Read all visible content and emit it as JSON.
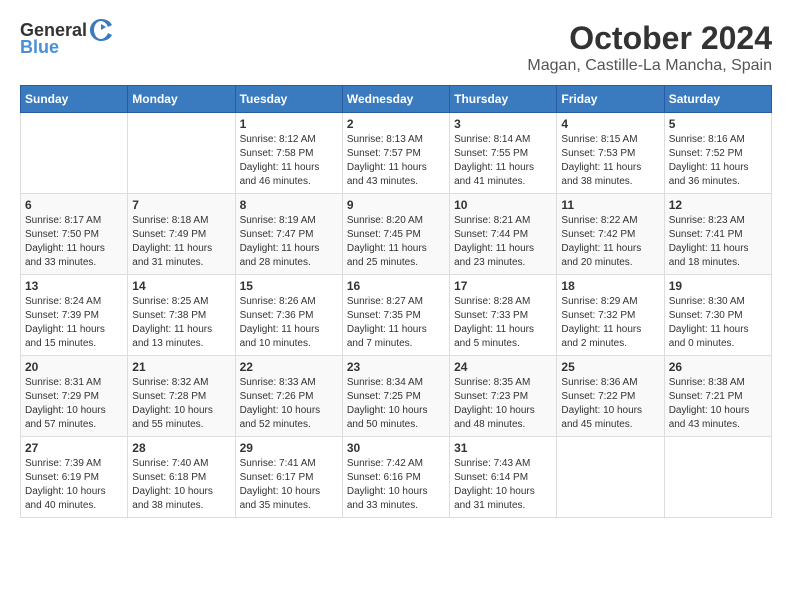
{
  "logo": {
    "general": "General",
    "blue": "Blue"
  },
  "title": "October 2024",
  "location": "Magan, Castille-La Mancha, Spain",
  "weekdays": [
    "Sunday",
    "Monday",
    "Tuesday",
    "Wednesday",
    "Thursday",
    "Friday",
    "Saturday"
  ],
  "weeks": [
    [
      {
        "day": "",
        "info": ""
      },
      {
        "day": "",
        "info": ""
      },
      {
        "day": "1",
        "sunrise": "Sunrise: 8:12 AM",
        "sunset": "Sunset: 7:58 PM",
        "daylight": "Daylight: 11 hours and 46 minutes."
      },
      {
        "day": "2",
        "sunrise": "Sunrise: 8:13 AM",
        "sunset": "Sunset: 7:57 PM",
        "daylight": "Daylight: 11 hours and 43 minutes."
      },
      {
        "day": "3",
        "sunrise": "Sunrise: 8:14 AM",
        "sunset": "Sunset: 7:55 PM",
        "daylight": "Daylight: 11 hours and 41 minutes."
      },
      {
        "day": "4",
        "sunrise": "Sunrise: 8:15 AM",
        "sunset": "Sunset: 7:53 PM",
        "daylight": "Daylight: 11 hours and 38 minutes."
      },
      {
        "day": "5",
        "sunrise": "Sunrise: 8:16 AM",
        "sunset": "Sunset: 7:52 PM",
        "daylight": "Daylight: 11 hours and 36 minutes."
      }
    ],
    [
      {
        "day": "6",
        "sunrise": "Sunrise: 8:17 AM",
        "sunset": "Sunset: 7:50 PM",
        "daylight": "Daylight: 11 hours and 33 minutes."
      },
      {
        "day": "7",
        "sunrise": "Sunrise: 8:18 AM",
        "sunset": "Sunset: 7:49 PM",
        "daylight": "Daylight: 11 hours and 31 minutes."
      },
      {
        "day": "8",
        "sunrise": "Sunrise: 8:19 AM",
        "sunset": "Sunset: 7:47 PM",
        "daylight": "Daylight: 11 hours and 28 minutes."
      },
      {
        "day": "9",
        "sunrise": "Sunrise: 8:20 AM",
        "sunset": "Sunset: 7:45 PM",
        "daylight": "Daylight: 11 hours and 25 minutes."
      },
      {
        "day": "10",
        "sunrise": "Sunrise: 8:21 AM",
        "sunset": "Sunset: 7:44 PM",
        "daylight": "Daylight: 11 hours and 23 minutes."
      },
      {
        "day": "11",
        "sunrise": "Sunrise: 8:22 AM",
        "sunset": "Sunset: 7:42 PM",
        "daylight": "Daylight: 11 hours and 20 minutes."
      },
      {
        "day": "12",
        "sunrise": "Sunrise: 8:23 AM",
        "sunset": "Sunset: 7:41 PM",
        "daylight": "Daylight: 11 hours and 18 minutes."
      }
    ],
    [
      {
        "day": "13",
        "sunrise": "Sunrise: 8:24 AM",
        "sunset": "Sunset: 7:39 PM",
        "daylight": "Daylight: 11 hours and 15 minutes."
      },
      {
        "day": "14",
        "sunrise": "Sunrise: 8:25 AM",
        "sunset": "Sunset: 7:38 PM",
        "daylight": "Daylight: 11 hours and 13 minutes."
      },
      {
        "day": "15",
        "sunrise": "Sunrise: 8:26 AM",
        "sunset": "Sunset: 7:36 PM",
        "daylight": "Daylight: 11 hours and 10 minutes."
      },
      {
        "day": "16",
        "sunrise": "Sunrise: 8:27 AM",
        "sunset": "Sunset: 7:35 PM",
        "daylight": "Daylight: 11 hours and 7 minutes."
      },
      {
        "day": "17",
        "sunrise": "Sunrise: 8:28 AM",
        "sunset": "Sunset: 7:33 PM",
        "daylight": "Daylight: 11 hours and 5 minutes."
      },
      {
        "day": "18",
        "sunrise": "Sunrise: 8:29 AM",
        "sunset": "Sunset: 7:32 PM",
        "daylight": "Daylight: 11 hours and 2 minutes."
      },
      {
        "day": "19",
        "sunrise": "Sunrise: 8:30 AM",
        "sunset": "Sunset: 7:30 PM",
        "daylight": "Daylight: 11 hours and 0 minutes."
      }
    ],
    [
      {
        "day": "20",
        "sunrise": "Sunrise: 8:31 AM",
        "sunset": "Sunset: 7:29 PM",
        "daylight": "Daylight: 10 hours and 57 minutes."
      },
      {
        "day": "21",
        "sunrise": "Sunrise: 8:32 AM",
        "sunset": "Sunset: 7:28 PM",
        "daylight": "Daylight: 10 hours and 55 minutes."
      },
      {
        "day": "22",
        "sunrise": "Sunrise: 8:33 AM",
        "sunset": "Sunset: 7:26 PM",
        "daylight": "Daylight: 10 hours and 52 minutes."
      },
      {
        "day": "23",
        "sunrise": "Sunrise: 8:34 AM",
        "sunset": "Sunset: 7:25 PM",
        "daylight": "Daylight: 10 hours and 50 minutes."
      },
      {
        "day": "24",
        "sunrise": "Sunrise: 8:35 AM",
        "sunset": "Sunset: 7:23 PM",
        "daylight": "Daylight: 10 hours and 48 minutes."
      },
      {
        "day": "25",
        "sunrise": "Sunrise: 8:36 AM",
        "sunset": "Sunset: 7:22 PM",
        "daylight": "Daylight: 10 hours and 45 minutes."
      },
      {
        "day": "26",
        "sunrise": "Sunrise: 8:38 AM",
        "sunset": "Sunset: 7:21 PM",
        "daylight": "Daylight: 10 hours and 43 minutes."
      }
    ],
    [
      {
        "day": "27",
        "sunrise": "Sunrise: 7:39 AM",
        "sunset": "Sunset: 6:19 PM",
        "daylight": "Daylight: 10 hours and 40 minutes."
      },
      {
        "day": "28",
        "sunrise": "Sunrise: 7:40 AM",
        "sunset": "Sunset: 6:18 PM",
        "daylight": "Daylight: 10 hours and 38 minutes."
      },
      {
        "day": "29",
        "sunrise": "Sunrise: 7:41 AM",
        "sunset": "Sunset: 6:17 PM",
        "daylight": "Daylight: 10 hours and 35 minutes."
      },
      {
        "day": "30",
        "sunrise": "Sunrise: 7:42 AM",
        "sunset": "Sunset: 6:16 PM",
        "daylight": "Daylight: 10 hours and 33 minutes."
      },
      {
        "day": "31",
        "sunrise": "Sunrise: 7:43 AM",
        "sunset": "Sunset: 6:14 PM",
        "daylight": "Daylight: 10 hours and 31 minutes."
      },
      {
        "day": "",
        "info": ""
      },
      {
        "day": "",
        "info": ""
      }
    ]
  ]
}
